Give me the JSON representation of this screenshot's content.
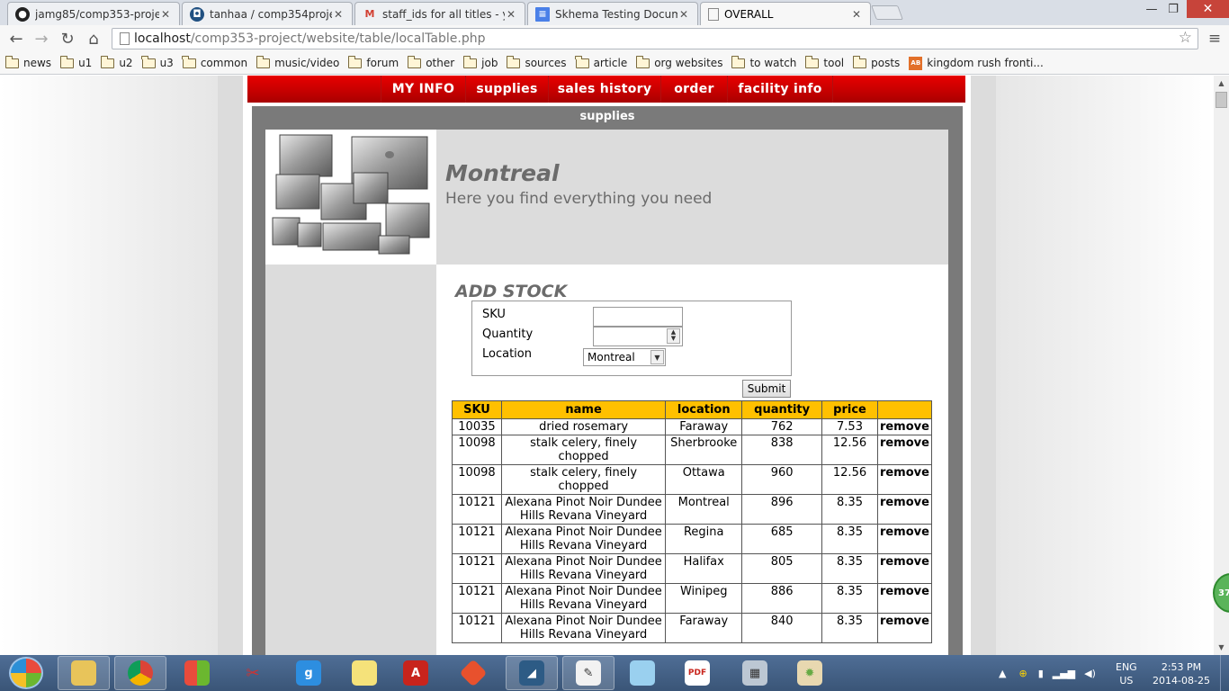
{
  "browser": {
    "tabs": [
      {
        "label": "jamg85/comp353-project",
        "icon": "github-icon"
      },
      {
        "label": "tanhaa / comp354project",
        "icon": "bitbucket-icon"
      },
      {
        "label": "staff_ids for all titles - yipa",
        "icon": "gmail-icon"
      },
      {
        "label": "Skhema Testing Documer",
        "icon": "docs-icon"
      },
      {
        "label": "OVERALL",
        "icon": "page-icon"
      }
    ],
    "url_host": "localhost",
    "url_path": "/comp353-project/website/table/localTable.php",
    "bookmarks": [
      "news",
      "u1",
      "u2",
      "u3",
      "common",
      "music/video",
      "forum",
      "other",
      "job",
      "sources",
      "article",
      "org websites",
      "to watch",
      "tool",
      "posts",
      "kingdom rush fronti..."
    ]
  },
  "site": {
    "nav": [
      "MY INFO",
      "supplies",
      "sales history",
      "order",
      "facility info"
    ],
    "section_title": "supplies",
    "city": "Montreal",
    "tagline": "Here you find everything you need",
    "form": {
      "title": "ADD STOCK",
      "sku_label": "SKU",
      "quantity_label": "Quantity",
      "location_label": "Location",
      "location_value": "Montreal",
      "submit_label": "Submit"
    },
    "table": {
      "headers": [
        "SKU",
        "name",
        "location",
        "quantity",
        "price",
        ""
      ],
      "rows": [
        {
          "sku": "10035",
          "name": "dried rosemary",
          "location": "Faraway",
          "quantity": "762",
          "price": "7.53",
          "action": "remove"
        },
        {
          "sku": "10098",
          "name": "stalk celery, finely chopped",
          "location": "Sherbrooke",
          "quantity": "838",
          "price": "12.56",
          "action": "remove"
        },
        {
          "sku": "10098",
          "name": "stalk celery, finely chopped",
          "location": "Ottawa",
          "quantity": "960",
          "price": "12.56",
          "action": "remove"
        },
        {
          "sku": "10121",
          "name": "Alexana Pinot Noir Dundee Hills Revana Vineyard",
          "location": "Montreal",
          "quantity": "896",
          "price": "8.35",
          "action": "remove"
        },
        {
          "sku": "10121",
          "name": "Alexana Pinot Noir Dundee Hills Revana Vineyard",
          "location": "Regina",
          "quantity": "685",
          "price": "8.35",
          "action": "remove"
        },
        {
          "sku": "10121",
          "name": "Alexana Pinot Noir Dundee Hills Revana Vineyard",
          "location": "Halifax",
          "quantity": "805",
          "price": "8.35",
          "action": "remove"
        },
        {
          "sku": "10121",
          "name": "Alexana Pinot Noir Dundee Hills Revana Vineyard",
          "location": "Winipeg",
          "quantity": "886",
          "price": "8.35",
          "action": "remove"
        },
        {
          "sku": "10121",
          "name": "Alexana Pinot Noir Dundee Hills Revana Vineyard",
          "location": "Faraway",
          "quantity": "840",
          "price": "8.35",
          "action": "remove"
        }
      ]
    }
  },
  "taskbar": {
    "lang_line1": "ENG",
    "lang_line2": "US",
    "time": "2:53 PM",
    "date": "2014-08-25",
    "badge": "37"
  },
  "colors": {
    "nav_red": "#cc0000",
    "table_header": "#ffc000",
    "frame_gray": "#7a7a7a"
  }
}
